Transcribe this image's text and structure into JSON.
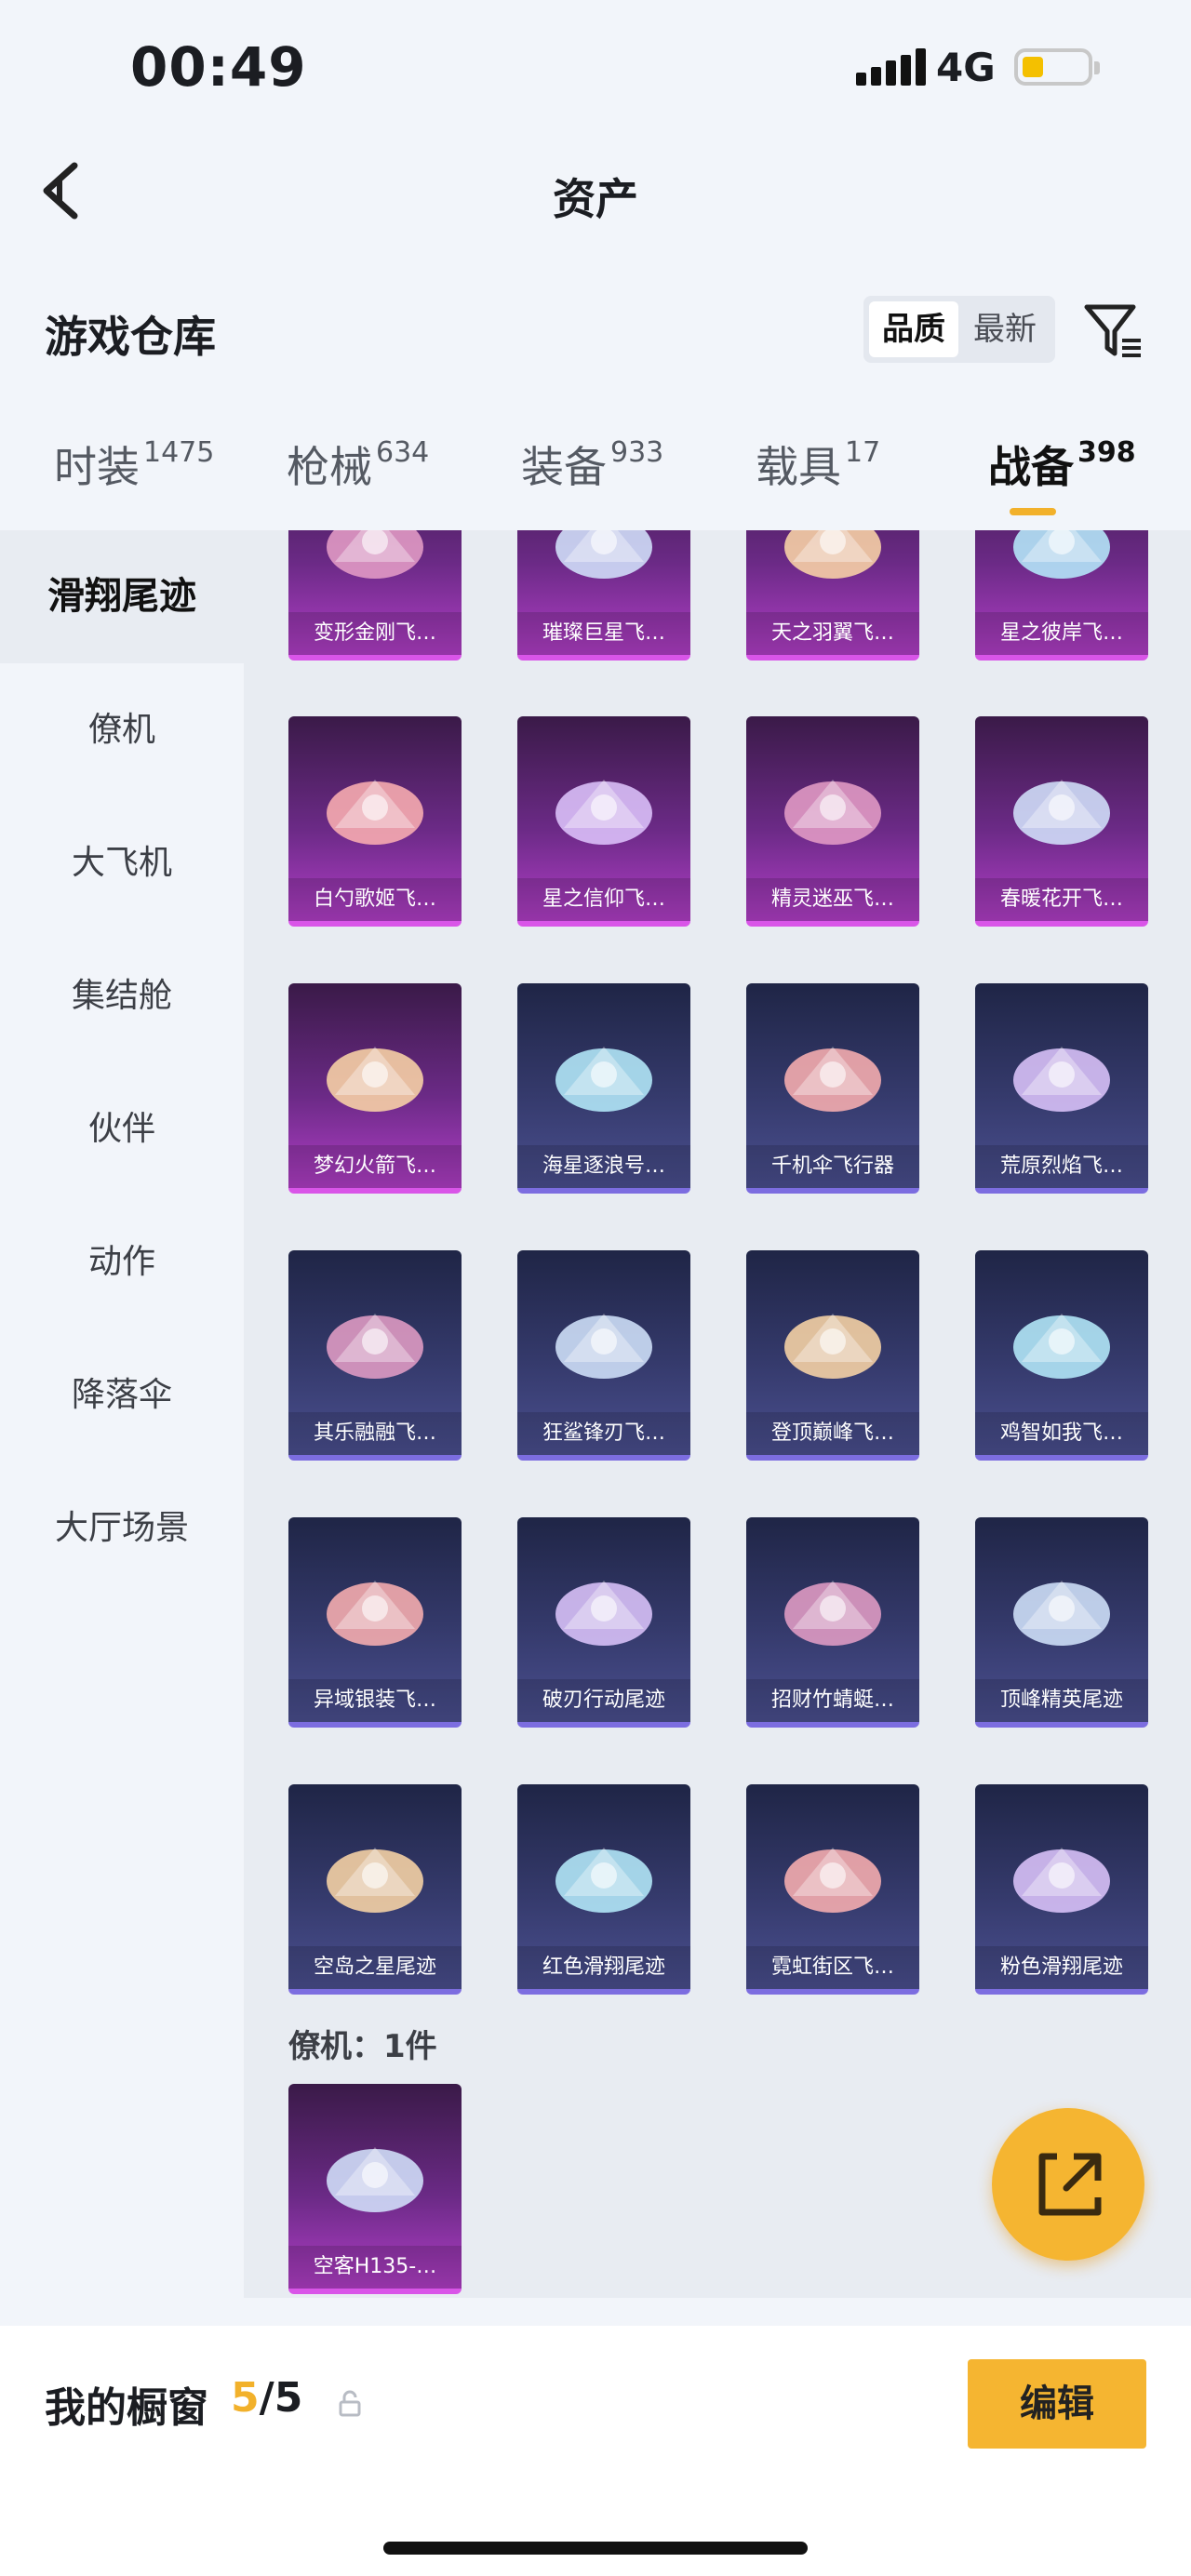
{
  "status": {
    "time": "00:49",
    "network": "4G"
  },
  "nav": {
    "title": "资产"
  },
  "section": {
    "title": "游戏仓库",
    "sort_quality": "品质",
    "sort_newest": "最新"
  },
  "tabs": [
    {
      "label": "时装",
      "count": "1475"
    },
    {
      "label": "枪械",
      "count": "634"
    },
    {
      "label": "装备",
      "count": "933"
    },
    {
      "label": "载具",
      "count": "17"
    },
    {
      "label": "战备",
      "count": "398"
    }
  ],
  "sidebar": [
    "滑翔尾迹",
    "僚机",
    "大飞机",
    "集结舱",
    "伙伴",
    "动作",
    "降落伞",
    "大厅场景"
  ],
  "grid_rows": [
    [
      {
        "name": "变形金刚飞…",
        "rarity": "purple"
      },
      {
        "name": "璀璨巨星飞…",
        "rarity": "purple"
      },
      {
        "name": "天之羽翼飞…",
        "rarity": "purple"
      },
      {
        "name": "星之彼岸飞…",
        "rarity": "purple"
      }
    ],
    [
      {
        "name": "白勺歌姬飞…",
        "rarity": "purple"
      },
      {
        "name": "星之信仰飞…",
        "rarity": "purple"
      },
      {
        "name": "精灵迷巫飞…",
        "rarity": "purple"
      },
      {
        "name": "春暖花开飞…",
        "rarity": "purple"
      }
    ],
    [
      {
        "name": "梦幻火箭飞…",
        "rarity": "purple"
      },
      {
        "name": "海星逐浪号…",
        "rarity": "blue"
      },
      {
        "name": "千机伞飞行器",
        "rarity": "blue"
      },
      {
        "name": "荒原烈焰飞…",
        "rarity": "blue"
      }
    ],
    [
      {
        "name": "其乐融融飞…",
        "rarity": "blue"
      },
      {
        "name": "狂鲨锋刃飞…",
        "rarity": "blue"
      },
      {
        "name": "登顶巅峰飞…",
        "rarity": "blue"
      },
      {
        "name": "鸡智如我飞…",
        "rarity": "blue"
      }
    ],
    [
      {
        "name": "异域银装飞…",
        "rarity": "blue"
      },
      {
        "name": "破刃行动尾迹",
        "rarity": "blue"
      },
      {
        "name": "招财竹蜻蜓…",
        "rarity": "blue"
      },
      {
        "name": "顶峰精英尾迹",
        "rarity": "blue"
      }
    ],
    [
      {
        "name": "空岛之星尾迹",
        "rarity": "blue"
      },
      {
        "name": "红色滑翔尾迹",
        "rarity": "blue"
      },
      {
        "name": "霓虹街区飞…",
        "rarity": "blue"
      },
      {
        "name": "粉色滑翔尾迹",
        "rarity": "blue"
      }
    ]
  ],
  "wingman_group": {
    "label": "僚机：1件",
    "items": [
      {
        "name": "空客H135-…",
        "rarity": "purple"
      }
    ]
  },
  "bottom": {
    "showcase_label": "我的橱窗",
    "count_current": "5",
    "count_total": "/5",
    "edit_label": "编辑"
  },
  "colors": {
    "accent": "#f5b531",
    "purple_rarity": "#d955e8",
    "blue_rarity": "#7c6de0"
  }
}
